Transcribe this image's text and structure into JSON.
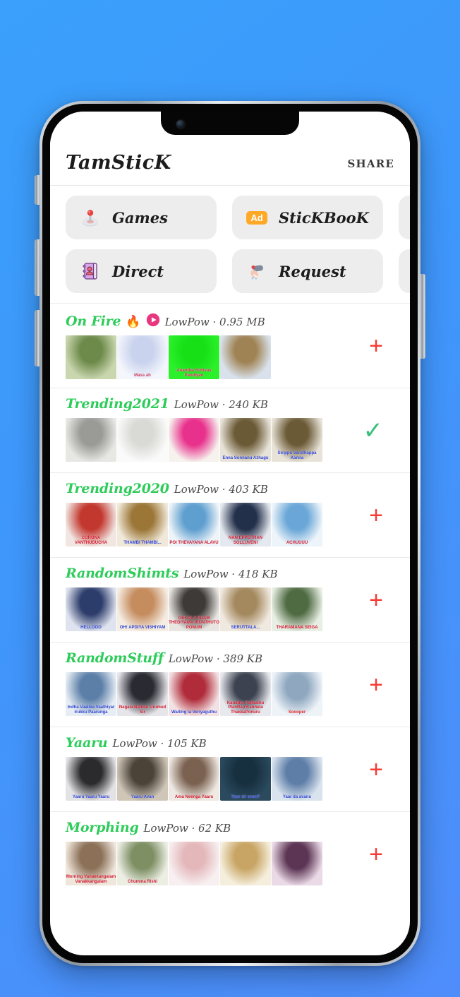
{
  "background": {
    "gradient_from": "#3aa0fb",
    "gradient_to": "#4f8dfb"
  },
  "header": {
    "title": "TamSticK",
    "share_label": "SHARE"
  },
  "actions": {
    "row1": [
      {
        "label": "Games",
        "icon": "joystick-icon"
      },
      {
        "label": "SticKBooK",
        "icon": "ad-badge-icon",
        "badge": "Ad"
      },
      {
        "label": "",
        "icon": "gear-icon"
      }
    ],
    "row2": [
      {
        "label": "Direct",
        "icon": "contact-book-icon"
      },
      {
        "label": "Request",
        "icon": "megaphone-icon"
      },
      {
        "label": "",
        "icon": "info-icon"
      }
    ]
  },
  "colors": {
    "pack_name_green": "#2ecc5a",
    "plus_red": "#f53b33",
    "check_green": "#35c07a",
    "ad_orange": "#ffa929",
    "play_pink": "#e8377f"
  },
  "packs": [
    {
      "name": "On Fire",
      "emoji": "🔥",
      "has_play_icon": true,
      "author": "LowPow",
      "separator": "·",
      "size": "0.95 MB",
      "action": "add",
      "action_glyph": "+",
      "stickers": [
        {
          "caption": "",
          "c1": "#6d8a4a",
          "c2": "#c9d6ae"
        },
        {
          "caption": "Mass ah",
          "cap_color": "#c43a5e",
          "c1": "#c9d3ee",
          "c2": "#f4f6fc"
        },
        {
          "caption": "Anantha Srinivas Pandiyan",
          "cap_color": "#e01f5a",
          "c1": "#17e017",
          "c2": "#2bf02b"
        },
        {
          "caption": "",
          "c1": "#a08354",
          "c2": "#d9e2ec"
        }
      ]
    },
    {
      "name": "Trending2021",
      "emoji": "",
      "has_play_icon": false,
      "author": "LowPow",
      "separator": "·",
      "size": "240 KB",
      "action": "added",
      "action_glyph": "✓",
      "stickers": [
        {
          "caption": "",
          "c1": "#9a9a96",
          "c2": "#e7e7e3"
        },
        {
          "caption": "",
          "c1": "#d9d9d5",
          "c2": "#fafafa"
        },
        {
          "caption": "",
          "c1": "#e8318c",
          "c2": "#f6f2ee"
        },
        {
          "caption": "Enna Sonnanu Azhagu",
          "cap_color": "#2b3fd0",
          "c1": "#6b5a36",
          "c2": "#e8e3d8"
        },
        {
          "caption": "Sirippu Varuthappa Kanna",
          "cap_color": "#2b3fd0",
          "c1": "#6b5a36",
          "c2": "#e8e3d8"
        }
      ]
    },
    {
      "name": "Trending2020",
      "emoji": "",
      "has_play_icon": false,
      "author": "LowPow",
      "separator": "·",
      "size": "403 KB",
      "action": "add",
      "action_glyph": "+",
      "stickers": [
        {
          "caption": "CORONA VANTHUDUCHA",
          "cap_color": "#d0142a",
          "c1": "#c2382f",
          "c2": "#f1e6e2"
        },
        {
          "caption": "THAMBI THAMBI...",
          "cap_color": "#2b3fd0",
          "c1": "#9b7637",
          "c2": "#f0e8d8"
        },
        {
          "caption": "POI THEVAYANA ALAVU",
          "cap_color": "#d0142a",
          "c1": "#5f9fd0",
          "c2": "#eef4f8"
        },
        {
          "caption": "NAN EPPOTHAN SOLLUVENI",
          "cap_color": "#d0142a",
          "c1": "#23304a",
          "c2": "#e4e8ef"
        },
        {
          "caption": "ACHUUUU",
          "cap_color": "#d0142a",
          "c1": "#6aa7d8",
          "c2": "#eef5fa"
        }
      ]
    },
    {
      "name": "RandomShimts",
      "emoji": "",
      "has_play_icon": false,
      "author": "LowPow",
      "separator": "·",
      "size": "418 KB",
      "action": "add",
      "action_glyph": "+",
      "stickers": [
        {
          "caption": "HELLOOO",
          "cap_color": "#2b3fd0",
          "c1": "#2c3c6b",
          "c2": "#dfe3ef"
        },
        {
          "caption": "OH! APDIYA VISHIYAM",
          "cap_color": "#2b3fd0",
          "c1": "#c58c5e",
          "c2": "#f5ece2"
        },
        {
          "caption": "OKKALA EDAM THEDIYAMA IRUNTHUTO PONUM",
          "cap_color": "#d0142a",
          "c1": "#3d3a38",
          "c2": "#e9e6e2"
        },
        {
          "caption": "SERUTTALA...",
          "cap_color": "#2b3fd0",
          "c1": "#a4895f",
          "c2": "#f0e9df"
        },
        {
          "caption": "THARAMANA SEIGA",
          "cap_color": "#d0142a",
          "c1": "#4f6b42",
          "c2": "#e7eee3"
        }
      ]
    },
    {
      "name": "RandomStuff",
      "emoji": "",
      "has_play_icon": false,
      "author": "LowPow",
      "separator": "·",
      "size": "389 KB",
      "action": "add",
      "action_glyph": "+",
      "stickers": [
        {
          "caption": "Indha Vaaliba Vaathiyar Irukku Paarunga",
          "cap_color": "#2b3fd0",
          "c1": "#5c7fa8",
          "c2": "#e6edf4"
        },
        {
          "caption": "Nagala Bambu Urumud Sir",
          "cap_color": "#d0142a",
          "c1": "#2a2a32",
          "c2": "#e5e5ea"
        },
        {
          "caption": "Waiting la Veriyaguthu",
          "cap_color": "#2b3fd0",
          "c1": "#b02c3a",
          "c2": "#f3e2e4"
        },
        {
          "caption": "Kanathu Pakkathu PlanRap Kannula ThakkaPonuru",
          "cap_color": "#d0142a",
          "c1": "#3c4250",
          "c2": "#e7e9ee"
        },
        {
          "caption": "Soooper",
          "cap_color": "#e02424",
          "c1": "#8fa8c0",
          "c2": "#eef3f8"
        }
      ]
    },
    {
      "name": "Yaaru",
      "emoji": "",
      "has_play_icon": false,
      "author": "LowPow",
      "separator": "·",
      "size": "105 KB",
      "action": "add",
      "action_glyph": "+",
      "stickers": [
        {
          "caption": "Yaaru Yaaru Yaaru",
          "cap_color": "#2b3fd0",
          "c1": "#2b2b2e",
          "c2": "#e3e3e6"
        },
        {
          "caption": "Yaaru Avan",
          "cap_color": "#2b3fd0",
          "c1": "#4b4338",
          "c2": "#cfc6b8"
        },
        {
          "caption": "Ama Neenga Yaaru",
          "cap_color": "#d0142a",
          "c1": "#7a6150",
          "c2": "#efe9e3"
        },
        {
          "caption": "Yaar sir avan?",
          "cap_color": "#2b3fd0",
          "c1": "#17303f",
          "c2": "#2b4a5e"
        },
        {
          "caption": "Yaar da avanu",
          "cap_color": "#2b3fd0",
          "c1": "#5e7ea8",
          "c2": "#d9e3ee"
        }
      ]
    },
    {
      "name": "Morphing",
      "emoji": "",
      "has_play_icon": false,
      "author": "LowPow",
      "separator": "·",
      "size": "62 KB",
      "action": "add",
      "action_glyph": "+",
      "stickers": [
        {
          "caption": "Morning Vanakkangalam Vanakkangalam",
          "cap_color": "#d0142a",
          "c1": "#8c7158",
          "c2": "#efe6dc"
        },
        {
          "caption": "Chumma Rishi",
          "cap_color": "#d0142a",
          "c1": "#7d8f63",
          "c2": "#eceee4"
        },
        {
          "caption": "",
          "c1": "#e4b8bb",
          "c2": "#f7eff0"
        },
        {
          "caption": "",
          "c1": "#c8a564",
          "c2": "#f5eedc"
        },
        {
          "caption": "",
          "c1": "#5c3554",
          "c2": "#ead9e6"
        }
      ]
    }
  ]
}
